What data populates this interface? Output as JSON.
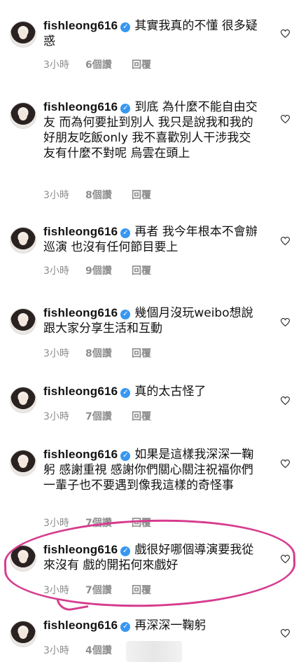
{
  "comments": [
    {
      "username": "fishleong616",
      "text": "其實我真的不懂 很多疑惑",
      "time": "3小時",
      "likes": "6個讚",
      "reply": "回覆"
    },
    {
      "username": "fishleong616",
      "text": "到底 為什麼不能自由交友 而為何要扯到別人 我只是說我和我的好朋友吃飯only 我不喜歡別人干涉我交友有什麼不對呢 烏雲在頭上",
      "time": "3小時",
      "likes": "8個讚",
      "reply": "回覆"
    },
    {
      "username": "fishleong616",
      "text": "再者 我今年根本不會辦巡演 也沒有任何節目要上",
      "time": "3小時",
      "likes": "9個讚",
      "reply": "回覆"
    },
    {
      "username": "fishleong616",
      "text": "幾個月沒玩weibo想說跟大家分享生活和互動",
      "time": "3小時",
      "likes": "8個讚",
      "reply": "回覆"
    },
    {
      "username": "fishleong616",
      "text": "真的太古怪了",
      "time": "3小時",
      "likes": "7個讚",
      "reply": "回覆"
    },
    {
      "username": "fishleong616",
      "text": "如果是這樣我深深一鞠躬 感謝重視 感謝你們關心關注祝福你們一輩子也不要遇到像我這樣的奇怪事",
      "time": "3小時",
      "likes": "7個讚",
      "reply": "回覆"
    },
    {
      "username": "fishleong616",
      "text": "戲很好哪個導演要我從來沒有 戲的開拓何來戲好",
      "time": "3小時",
      "likes": "7個讚",
      "reply": "回覆"
    },
    {
      "username": "fishleong616",
      "text": "再深深一鞠躬",
      "time": "3小時",
      "likes": "4個讚",
      "reply": ""
    }
  ],
  "colors": {
    "verified": "#3897f0",
    "meta": "#8e8e8e",
    "highlight_circle": "#d63c8e"
  },
  "icons": {
    "verified": "verified-badge-icon",
    "like": "heart-outline-icon"
  }
}
